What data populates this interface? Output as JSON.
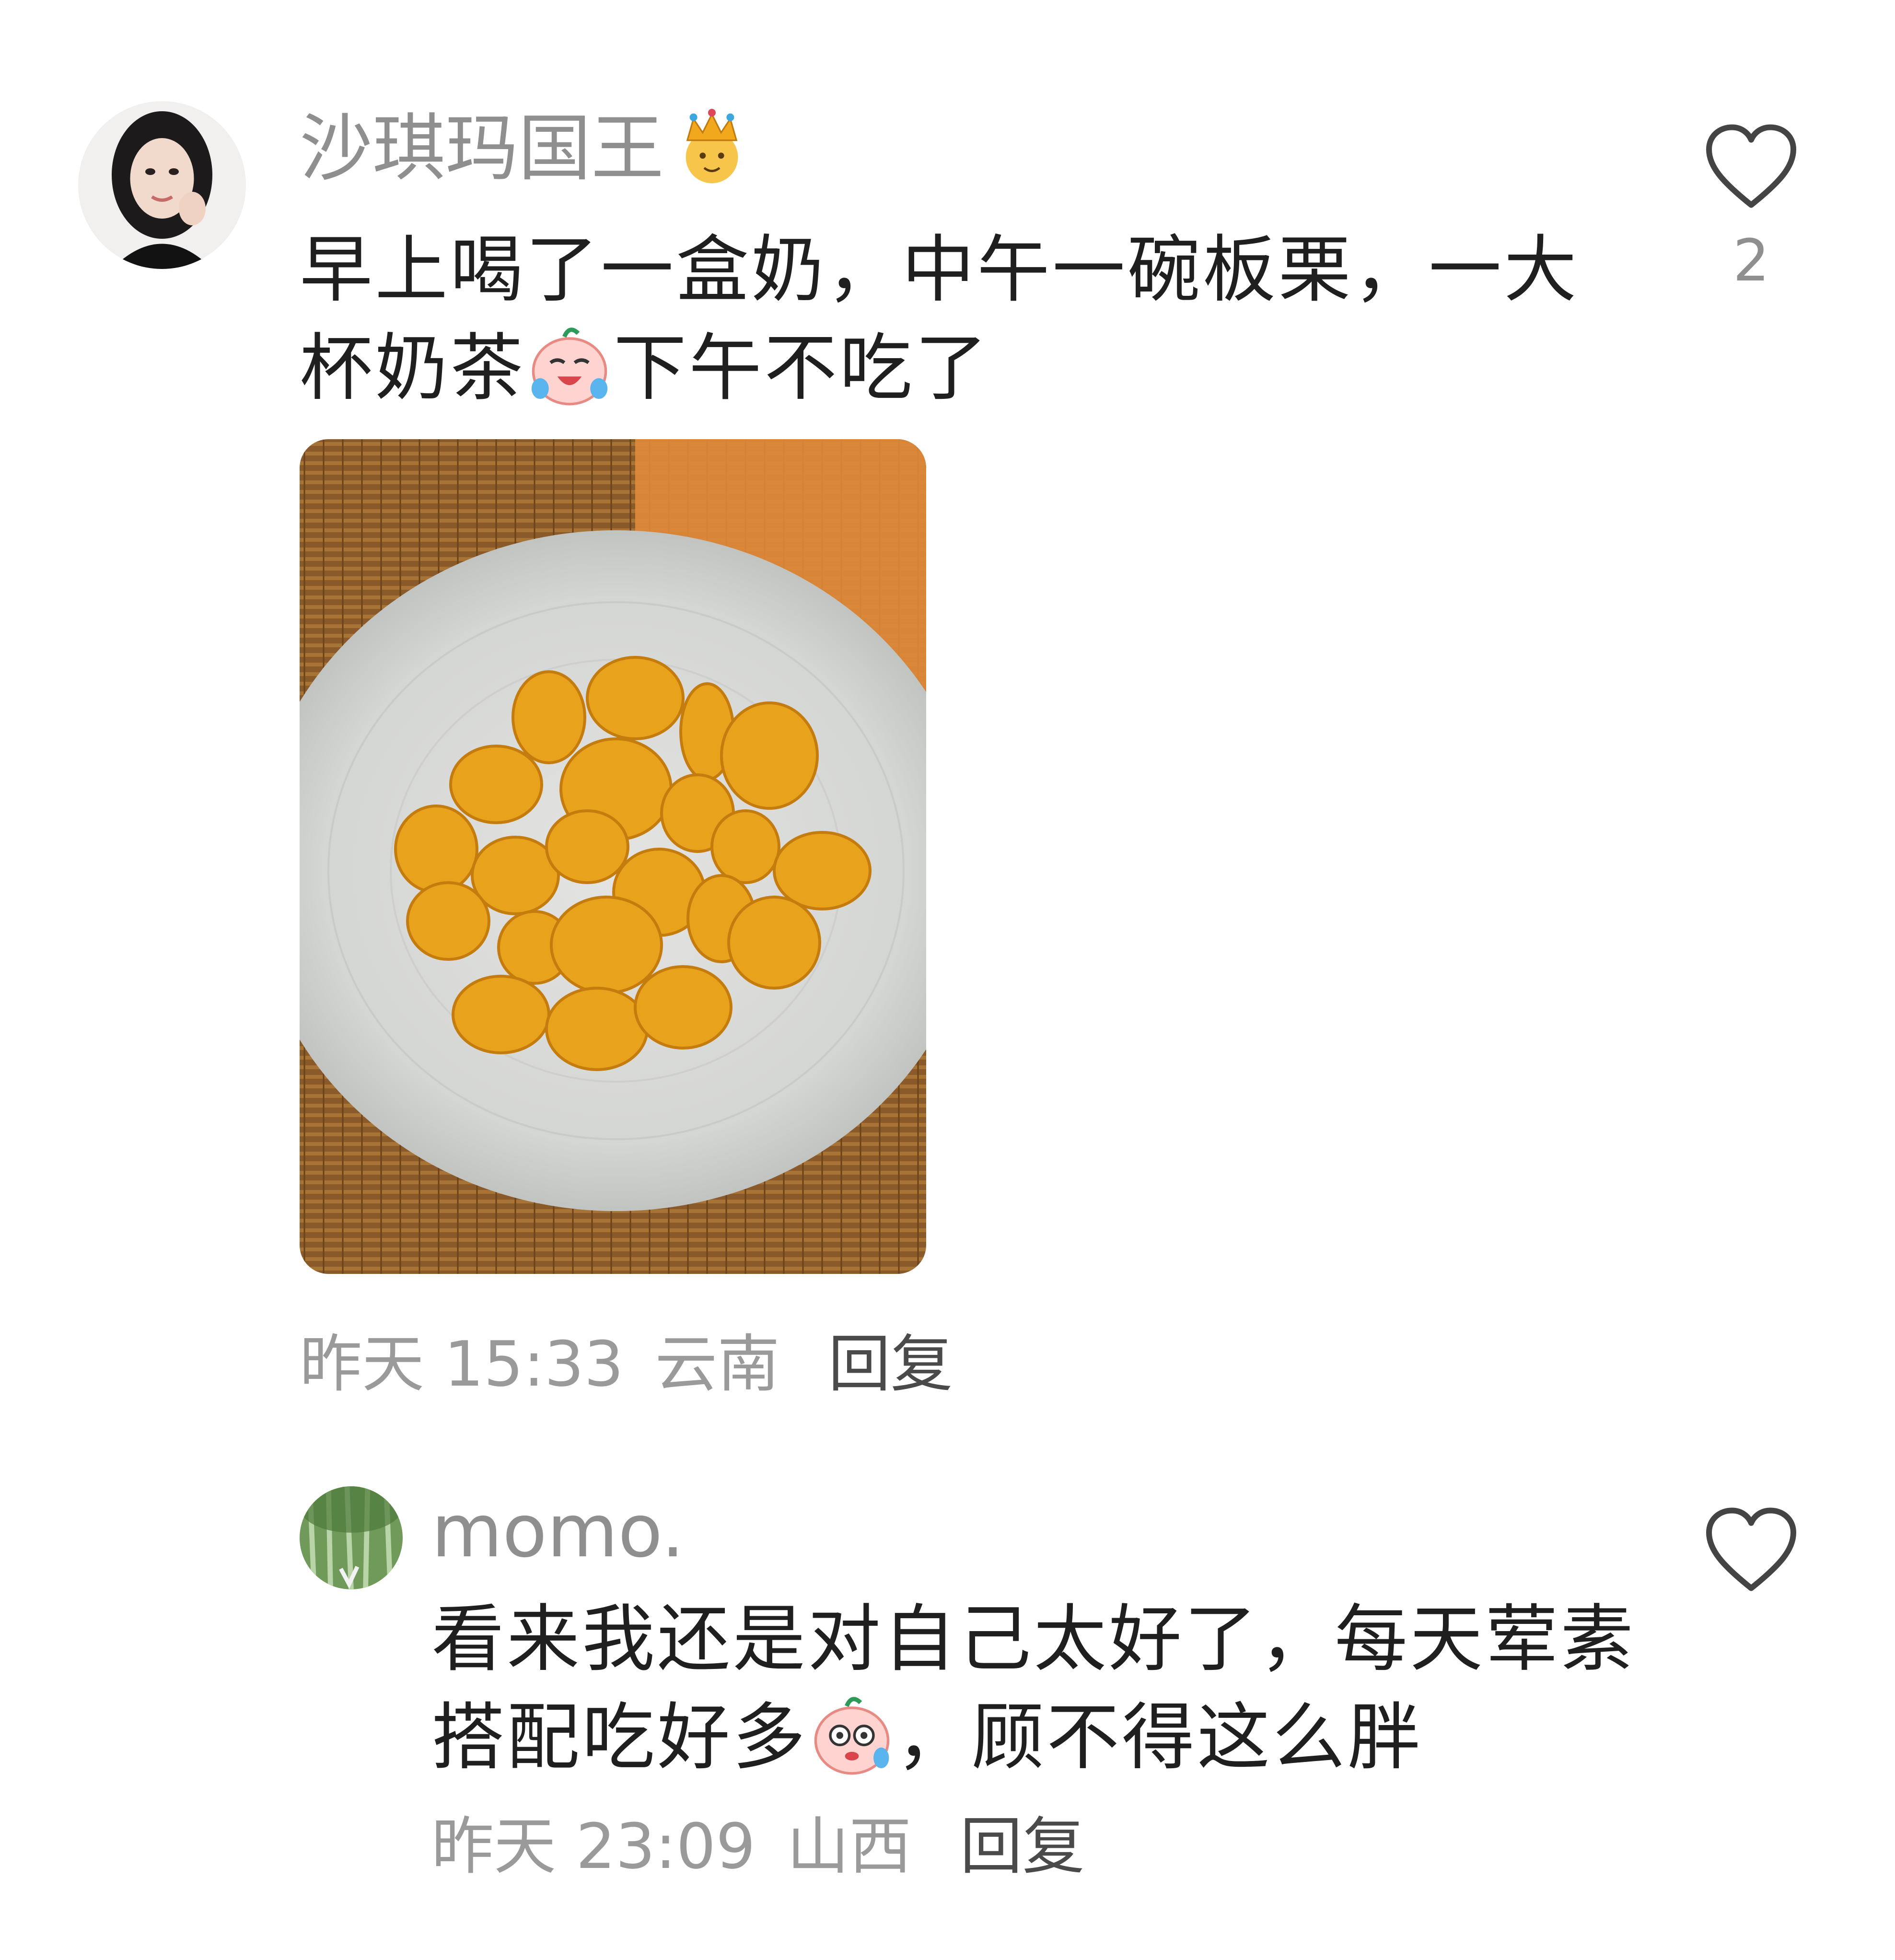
{
  "comments": [
    {
      "username": "沙琪玛国王",
      "badge_icon": "crown-person-emoji",
      "text_line1": "早上喝了一盒奶，中午一碗板栗，一大",
      "text_line2_a": "杯奶茶",
      "text_line2_emoji": "crying-laughing-peach-emoji",
      "text_line2_b": "下午不吃了",
      "image": "bowl-of-peeled-chestnuts-photo",
      "timestamp": "昨天 15:33",
      "location": "云南",
      "reply_label": "回复",
      "like_icon": "heart-outline-icon",
      "like_count": "2"
    },
    {
      "username": "momo.",
      "text_line1": "看来我还是对自己太好了，每天荤素",
      "text_line2_a": "搭配吃好多",
      "text_line2_emoji": "sweating-worried-peach-emoji",
      "text_line2_b": "，顾不得这么胖",
      "timestamp": "昨天 23:09",
      "location": "山西",
      "reply_label": "回复",
      "like_icon": "heart-outline-icon"
    }
  ],
  "colors": {
    "username": "#8f8f8f",
    "body_text": "#1f1f1f",
    "meta_text": "#9a9a9a",
    "reply_text": "#4a4a4a",
    "heart_stroke": "#444444"
  }
}
